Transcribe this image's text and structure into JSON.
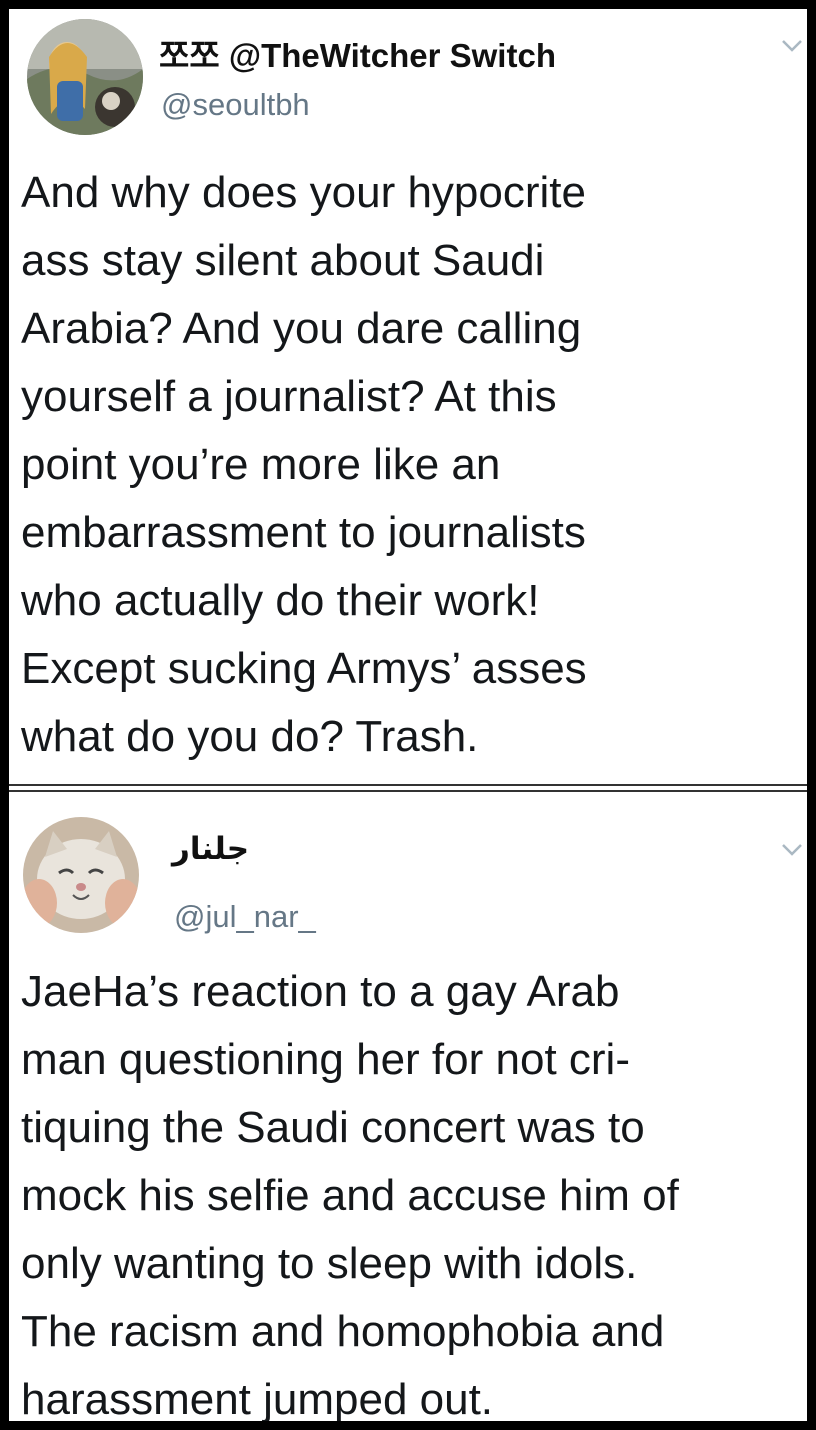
{
  "tweets": [
    {
      "display_name": "쪼쪼 @TheWitcher Switch",
      "handle": "@seoultbh",
      "avatar_icon": "avatar-zelda-illustration-icon",
      "menu_icon": "chevron-down-icon",
      "text": "And why does your hypocrite\nass stay silent about Saudi\nArabia? And you dare calling\nyourself a journalist? At this\npoint you’re more like an\nembarrassment to journalists\nwho actually do their work!\nExcept sucking Armys’ asses\nwhat do you do? Trash."
    },
    {
      "display_name": "جلنار",
      "handle": "@jul_nar_",
      "avatar_icon": "avatar-cat-icon",
      "menu_icon": "chevron-down-icon",
      "text": "JaeHa’s reaction to a gay Arab\nman questioning her for not cri-\ntiquing the Saudi concert was to\nmock his selfie and accuse him of\nonly wanting to sleep with idols.\nThe racism and homophobia and\nharassment jumped out."
    }
  ],
  "colors": {
    "text": "#14171a",
    "handle": "#657786",
    "background": "#ffffff",
    "border": "#000000"
  }
}
